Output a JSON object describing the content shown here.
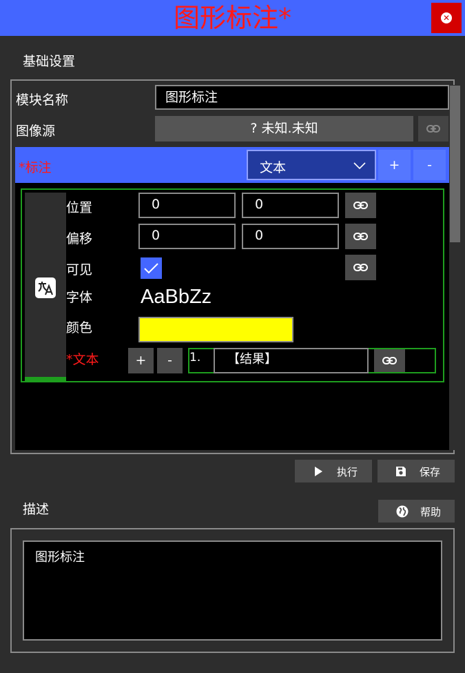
{
  "window": {
    "title": "图形标注*"
  },
  "basic": {
    "section_title": "基础设置",
    "module_name_label": "模块名称",
    "module_name_value": "图形标注",
    "image_source_label": "图像源",
    "image_source_value": "? 未知.未知"
  },
  "annotation": {
    "label": "*标注",
    "type_selected": "文本",
    "add_label": "+",
    "remove_label": "-"
  },
  "item": {
    "position_label": "位置",
    "position_x": "0",
    "position_y": "0",
    "offset_label": "偏移",
    "offset_x": "0",
    "offset_y": "0",
    "visible_label": "可见",
    "visible_checked": true,
    "font_label": "字体",
    "font_preview": "AaBbZz",
    "color_label": "颜色",
    "color_value": "#ffff00",
    "text_label": "*文本",
    "text_add": "+",
    "text_remove": "-",
    "text_index": "1.",
    "text_value": "【结果】"
  },
  "actions": {
    "run_label": "执行",
    "save_label": "保存",
    "help_label": "帮助"
  },
  "description": {
    "section_title": "描述",
    "text": "图形标注"
  },
  "colors": {
    "accent_blue": "#4466ff",
    "title_red": "#ff1a1a",
    "close_red": "#d40000",
    "green_border": "#1e9e1e"
  }
}
